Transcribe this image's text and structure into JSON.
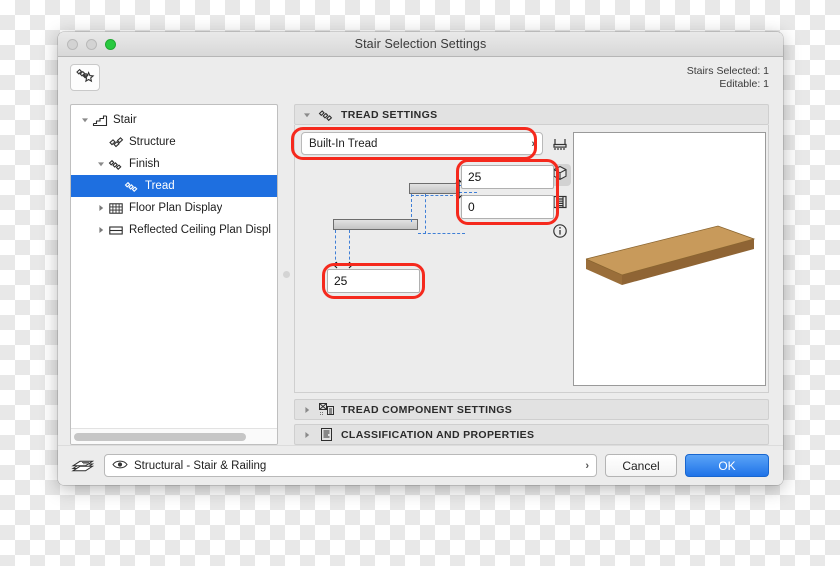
{
  "window": {
    "title": "Stair Selection Settings",
    "traffic_lights": [
      "close",
      "minimize",
      "zoom"
    ]
  },
  "header": {
    "favorites_icon": "stair-star-icon",
    "stairs_selected": "Stairs Selected: 1",
    "editable": "Editable: 1"
  },
  "tree": {
    "items": [
      {
        "label": "Stair",
        "icon": "stair-icon",
        "depth": 0,
        "twisty": "down",
        "selected": false
      },
      {
        "label": "Structure",
        "icon": "structure-icon",
        "depth": 1,
        "twisty": "none",
        "selected": false
      },
      {
        "label": "Finish",
        "icon": "finish-icon",
        "depth": 1,
        "twisty": "down",
        "selected": false
      },
      {
        "label": "Tread",
        "icon": "tread-icon",
        "depth": 2,
        "twisty": "none",
        "selected": true
      },
      {
        "label": "Floor Plan Display",
        "icon": "floor-plan-display-icon",
        "depth": 1,
        "twisty": "right",
        "selected": false
      },
      {
        "label": "Reflected Ceiling Plan Displ",
        "icon": "reflected-ceiling-icon",
        "depth": 1,
        "twisty": "right",
        "selected": false
      }
    ]
  },
  "tread_settings": {
    "section_title": "TREAD SETTINGS",
    "section_icon": "tread-icon",
    "twisty": "down",
    "type_value": "Built-In Tread",
    "type_chevron": "chevron-right-icon",
    "fields": [
      {
        "name": "tread-thickness",
        "value": "25"
      },
      {
        "name": "tread-nosing-offset",
        "value": "0"
      },
      {
        "name": "tread-overhang",
        "value": "25"
      }
    ]
  },
  "rail": {
    "buttons": [
      {
        "icon": "floor-plan-view-icon",
        "active": false
      },
      {
        "icon": "3d-view-icon",
        "active": true
      },
      {
        "icon": "section-view-icon",
        "active": false
      },
      {
        "icon": "info-icon",
        "active": false
      }
    ]
  },
  "preview": {
    "name": "3d-tread-preview",
    "wood_top": "#c89a5b",
    "wood_front": "#8f6434",
    "wood_side": "#a3763f"
  },
  "sections": [
    {
      "title": "TREAD COMPONENT SETTINGS",
      "icon": "tread-component-icon",
      "twisty": "right"
    },
    {
      "title": "CLASSIFICATION AND PROPERTIES",
      "icon": "classification-icon",
      "twisty": "right"
    }
  ],
  "footer": {
    "layer_icon": "layers-icon",
    "layer_eye_icon": "eye-icon",
    "layer_value": "Structural - Stair & Railing",
    "layer_chevron": "chevron-right-icon",
    "cancel_label": "Cancel",
    "ok_label": "OK"
  },
  "colors": {
    "selection_blue": "#1e6fe0",
    "highlight_red": "#f5291d",
    "ok_blue": "#1f73e8",
    "dimension_blue": "#3f7fd6"
  }
}
